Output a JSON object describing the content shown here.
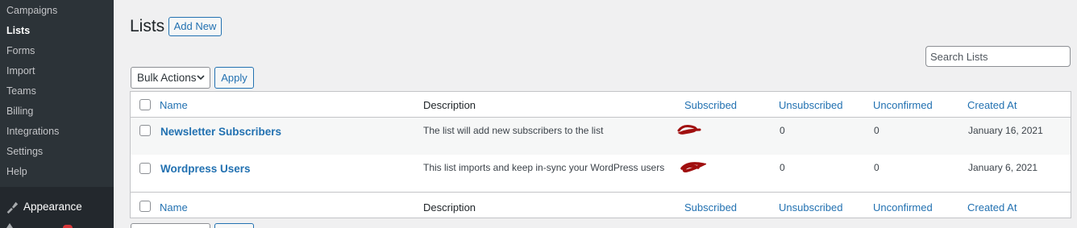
{
  "sidebar": {
    "submenu": [
      "Campaigns",
      "Lists",
      "Forms",
      "Import",
      "Teams",
      "Billing",
      "Integrations",
      "Settings",
      "Help"
    ],
    "active": "Lists",
    "appearance_label": "Appearance",
    "appearance_icon": "paintbrush-icon"
  },
  "page": {
    "title": "Lists",
    "add_new_label": "Add New"
  },
  "search": {
    "placeholder": "Search Lists",
    "value": ""
  },
  "bulk": {
    "selected": "Bulk Actions",
    "apply_label": "Apply"
  },
  "table": {
    "columns": [
      "Name",
      "Description",
      "Subscribed",
      "Unsubscribed",
      "Unconfirmed",
      "Created At"
    ],
    "rows": [
      {
        "name": "Newsletter Subscribers",
        "description": "The list will add new subscribers to the list",
        "subscribed": "",
        "unsubscribed": "0",
        "unconfirmed": "0",
        "created_at": "January 16, 2021"
      },
      {
        "name": "Wordpress Users",
        "description": "This list imports and keep in-sync your WordPress users",
        "subscribed": "",
        "unsubscribed": "0",
        "unconfirmed": "0",
        "created_at": "January 6, 2021"
      }
    ]
  },
  "colors": {
    "sidebar_bg": "#23282d",
    "submenu_bg": "#2c3338",
    "link": "#2271b1",
    "redaction": "#a00f0f"
  }
}
